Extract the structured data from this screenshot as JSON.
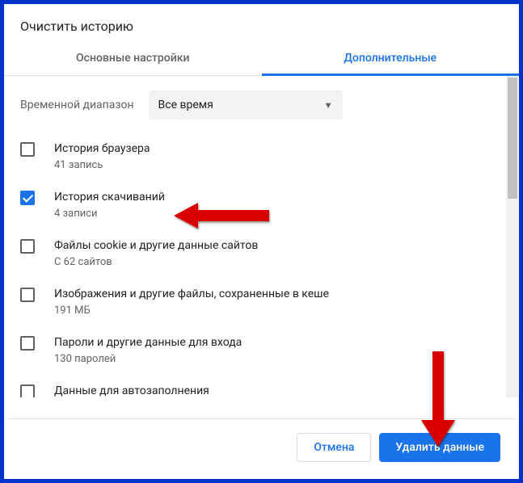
{
  "dialog": {
    "title": "Очистить историю"
  },
  "tabs": {
    "basic": "Основные настройки",
    "advanced": "Дополнительные"
  },
  "time": {
    "label": "Временной диапазон",
    "value": "Все время"
  },
  "options": [
    {
      "title": "История браузера",
      "sub": "41 запись",
      "checked": false
    },
    {
      "title": "История скачиваний",
      "sub": "4 записи",
      "checked": true
    },
    {
      "title": "Файлы cookie и другие данные сайтов",
      "sub": "С 62 сайтов",
      "checked": false
    },
    {
      "title": "Изображения и другие файлы, сохраненные в кеше",
      "sub": "191 МБ",
      "checked": false
    },
    {
      "title": "Пароли и другие данные для входа",
      "sub": "130 паролей",
      "checked": false
    },
    {
      "title": "Данные для автозаполнения",
      "sub": "",
      "checked": false
    }
  ],
  "footer": {
    "cancel": "Отмена",
    "delete": "Удалить данные"
  }
}
